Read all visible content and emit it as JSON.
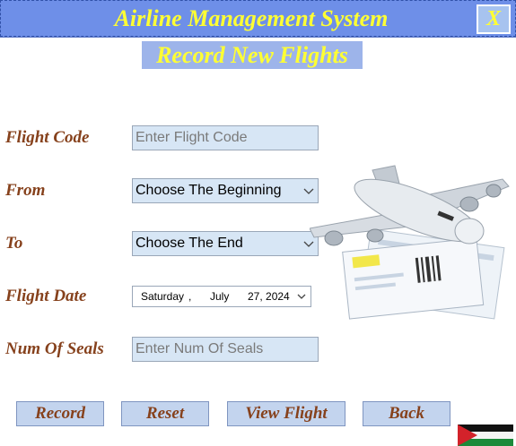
{
  "window": {
    "title": "Airline Management System",
    "close_label": "X"
  },
  "page": {
    "subtitle": "Record New Flights"
  },
  "form": {
    "flight_code": {
      "label": "Flight Code",
      "placeholder": "Enter Flight Code"
    },
    "from": {
      "label": "From",
      "value": "Choose The Beginning"
    },
    "to": {
      "label": "To",
      "value": "Choose The End"
    },
    "flight_date": {
      "label": "Flight Date",
      "weekday": "Saturday",
      "sep": ",",
      "month": "July",
      "day_year": "27, 2024"
    },
    "num_of_seats": {
      "label": "Num Of Seals",
      "placeholder": "Enter Num Of Seals"
    }
  },
  "buttons": {
    "record": "Record",
    "reset": "Reset",
    "view_flight": "View Flight",
    "back": "Back"
  },
  "icons": {
    "dropdown": "chevron-down-icon",
    "illustration": "airplane-ticket-illustration",
    "flag": "palestine-flag-icon"
  },
  "colors": {
    "titlebar": "#6e8fe8",
    "title_text": "#ffff33",
    "label_text": "#86411c",
    "field_bg": "#d7e6f5"
  }
}
